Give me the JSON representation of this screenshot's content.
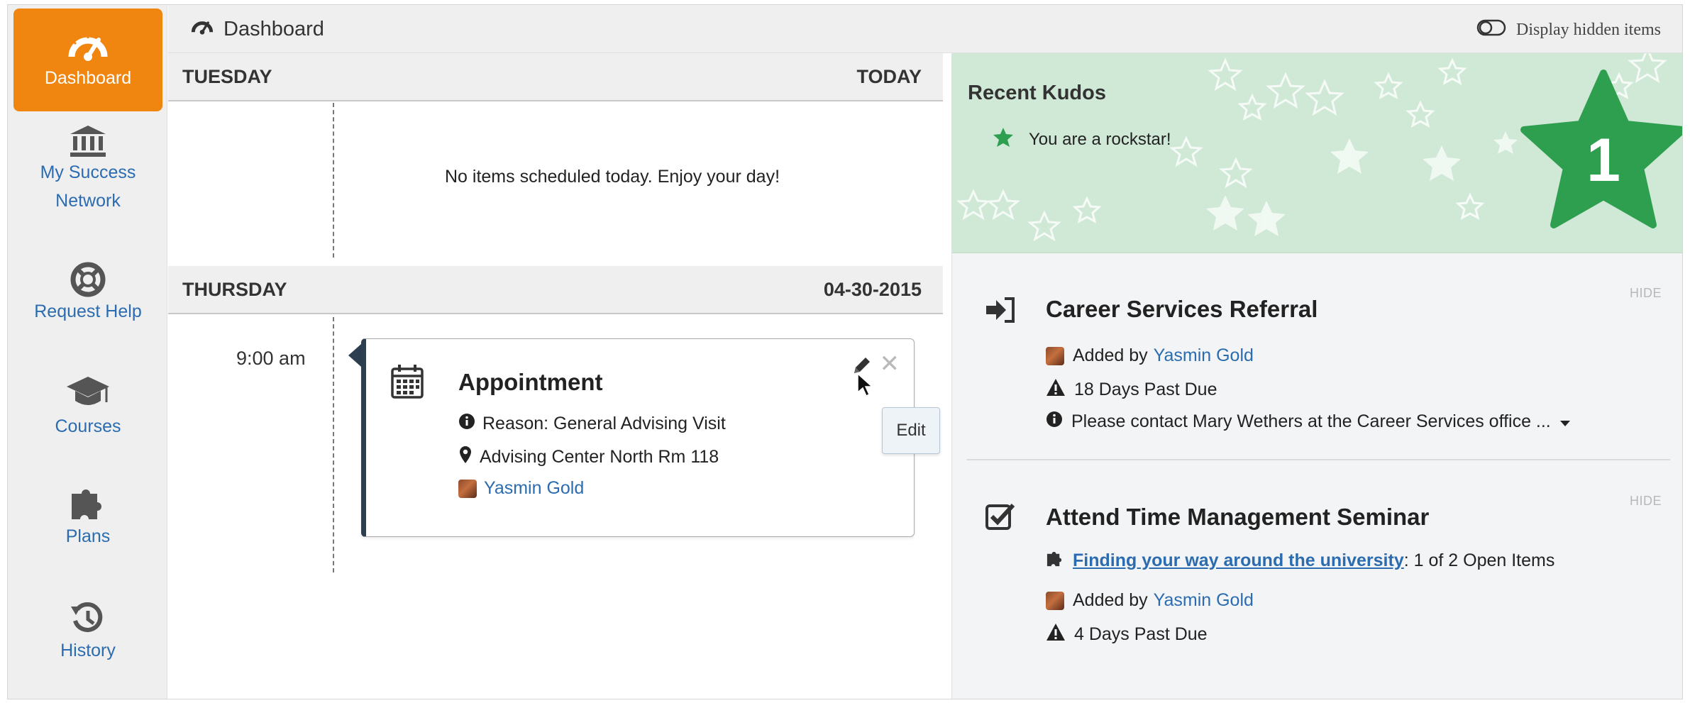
{
  "sidebar": {
    "items": [
      {
        "label": "Dashboard",
        "icon": "dashboard-icon",
        "active": true
      },
      {
        "label": "My Success Network",
        "icon": "bank-icon"
      },
      {
        "label": "Request Help",
        "icon": "lifebuoy-icon"
      },
      {
        "label": "Courses",
        "icon": "graduation-cap-icon"
      },
      {
        "label": "Plans",
        "icon": "puzzle-icon"
      },
      {
        "label": "History",
        "icon": "history-icon"
      }
    ]
  },
  "header": {
    "title": "Dashboard",
    "toggle_label": "Display hidden items"
  },
  "calendar": {
    "days": [
      {
        "name": "TUESDAY",
        "date": "TODAY",
        "empty_message": "No items scheduled today. Enjoy your day!"
      },
      {
        "name": "THURSDAY",
        "date": "04-30-2015"
      }
    ],
    "appointment": {
      "time": "9:00 am",
      "title": "Appointment",
      "reason": "Reason: General Advising Visit",
      "location": "Advising Center North Rm 118",
      "person": "Yasmin Gold",
      "tooltip": "Edit"
    }
  },
  "kudos": {
    "title": "Recent Kudos",
    "item": "You are a rockstar!",
    "count": "1"
  },
  "tasks": [
    {
      "title": "Career Services Referral",
      "hide_label": "HIDE",
      "added_prefix": "Added by",
      "added_by": "Yasmin Gold",
      "due": "18 Days Past Due",
      "note": "Please contact Mary Wethers at the Career Services office ..."
    },
    {
      "title": "Attend Time Management Seminar",
      "hide_label": "HIDE",
      "plan_link": "Finding your way around the university",
      "plan_suffix": ": 1 of 2 Open Items",
      "added_prefix": "Added by",
      "added_by": "Yasmin Gold",
      "due": "4 Days Past Due"
    }
  ],
  "colors": {
    "accent": "#f0860f",
    "link": "#2b6cb0",
    "kudos_bg": "#cfe9d6",
    "star": "#2e9e4f",
    "appointment_border": "#2d3e50"
  }
}
